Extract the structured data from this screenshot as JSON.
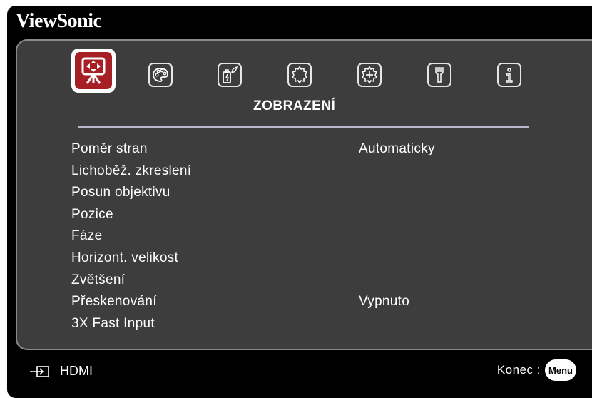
{
  "brand": "ViewSonic",
  "tabs": [
    {
      "icon": "display-icon",
      "active": true
    },
    {
      "icon": "palette-icon",
      "active": false
    },
    {
      "icon": "power-management-icon",
      "active": false
    },
    {
      "icon": "basic-settings-icon",
      "active": false
    },
    {
      "icon": "advanced-settings-icon",
      "active": false
    },
    {
      "icon": "maintenance-icon",
      "active": false
    },
    {
      "icon": "information-icon",
      "active": false
    }
  ],
  "section_title": "ZOBRAZENÍ",
  "menu": {
    "items": [
      {
        "label": "Poměr stran",
        "value": "Automaticky"
      },
      {
        "label": "Lichoběž. zkreslení",
        "value": ""
      },
      {
        "label": "Posun objektivu",
        "value": ""
      },
      {
        "label": "Pozice",
        "value": ""
      },
      {
        "label": "Fáze",
        "value": ""
      },
      {
        "label": "Horizont. velikost",
        "value": ""
      },
      {
        "label": "Zvětšení",
        "value": ""
      },
      {
        "label": "Přeskenování",
        "value": "Vypnuto"
      },
      {
        "label": "3X Fast Input",
        "value": ""
      }
    ]
  },
  "footer": {
    "source_icon": "input-source-icon",
    "source_label": "HDMI",
    "exit_label": "Konec :",
    "menu_button": "Menu"
  },
  "colors": {
    "panel": "#3d3d3d",
    "active_tab": "#a51f24",
    "divider": "#b9b6cf"
  }
}
